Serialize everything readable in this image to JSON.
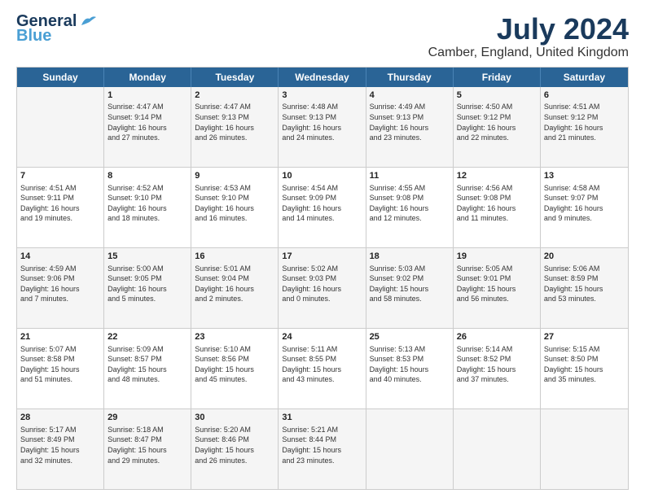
{
  "logo": {
    "line1": "General",
    "line2": "Blue"
  },
  "title": "July 2024",
  "subtitle": "Camber, England, United Kingdom",
  "days": [
    "Sunday",
    "Monday",
    "Tuesday",
    "Wednesday",
    "Thursday",
    "Friday",
    "Saturday"
  ],
  "weeks": [
    [
      {
        "day": "",
        "text": ""
      },
      {
        "day": "1",
        "text": "Sunrise: 4:47 AM\nSunset: 9:14 PM\nDaylight: 16 hours\nand 27 minutes."
      },
      {
        "day": "2",
        "text": "Sunrise: 4:47 AM\nSunset: 9:13 PM\nDaylight: 16 hours\nand 26 minutes."
      },
      {
        "day": "3",
        "text": "Sunrise: 4:48 AM\nSunset: 9:13 PM\nDaylight: 16 hours\nand 24 minutes."
      },
      {
        "day": "4",
        "text": "Sunrise: 4:49 AM\nSunset: 9:13 PM\nDaylight: 16 hours\nand 23 minutes."
      },
      {
        "day": "5",
        "text": "Sunrise: 4:50 AM\nSunset: 9:12 PM\nDaylight: 16 hours\nand 22 minutes."
      },
      {
        "day": "6",
        "text": "Sunrise: 4:51 AM\nSunset: 9:12 PM\nDaylight: 16 hours\nand 21 minutes."
      }
    ],
    [
      {
        "day": "7",
        "text": "Sunrise: 4:51 AM\nSunset: 9:11 PM\nDaylight: 16 hours\nand 19 minutes."
      },
      {
        "day": "8",
        "text": "Sunrise: 4:52 AM\nSunset: 9:10 PM\nDaylight: 16 hours\nand 18 minutes."
      },
      {
        "day": "9",
        "text": "Sunrise: 4:53 AM\nSunset: 9:10 PM\nDaylight: 16 hours\nand 16 minutes."
      },
      {
        "day": "10",
        "text": "Sunrise: 4:54 AM\nSunset: 9:09 PM\nDaylight: 16 hours\nand 14 minutes."
      },
      {
        "day": "11",
        "text": "Sunrise: 4:55 AM\nSunset: 9:08 PM\nDaylight: 16 hours\nand 12 minutes."
      },
      {
        "day": "12",
        "text": "Sunrise: 4:56 AM\nSunset: 9:08 PM\nDaylight: 16 hours\nand 11 minutes."
      },
      {
        "day": "13",
        "text": "Sunrise: 4:58 AM\nSunset: 9:07 PM\nDaylight: 16 hours\nand 9 minutes."
      }
    ],
    [
      {
        "day": "14",
        "text": "Sunrise: 4:59 AM\nSunset: 9:06 PM\nDaylight: 16 hours\nand 7 minutes."
      },
      {
        "day": "15",
        "text": "Sunrise: 5:00 AM\nSunset: 9:05 PM\nDaylight: 16 hours\nand 5 minutes."
      },
      {
        "day": "16",
        "text": "Sunrise: 5:01 AM\nSunset: 9:04 PM\nDaylight: 16 hours\nand 2 minutes."
      },
      {
        "day": "17",
        "text": "Sunrise: 5:02 AM\nSunset: 9:03 PM\nDaylight: 16 hours\nand 0 minutes."
      },
      {
        "day": "18",
        "text": "Sunrise: 5:03 AM\nSunset: 9:02 PM\nDaylight: 15 hours\nand 58 minutes."
      },
      {
        "day": "19",
        "text": "Sunrise: 5:05 AM\nSunset: 9:01 PM\nDaylight: 15 hours\nand 56 minutes."
      },
      {
        "day": "20",
        "text": "Sunrise: 5:06 AM\nSunset: 8:59 PM\nDaylight: 15 hours\nand 53 minutes."
      }
    ],
    [
      {
        "day": "21",
        "text": "Sunrise: 5:07 AM\nSunset: 8:58 PM\nDaylight: 15 hours\nand 51 minutes."
      },
      {
        "day": "22",
        "text": "Sunrise: 5:09 AM\nSunset: 8:57 PM\nDaylight: 15 hours\nand 48 minutes."
      },
      {
        "day": "23",
        "text": "Sunrise: 5:10 AM\nSunset: 8:56 PM\nDaylight: 15 hours\nand 45 minutes."
      },
      {
        "day": "24",
        "text": "Sunrise: 5:11 AM\nSunset: 8:55 PM\nDaylight: 15 hours\nand 43 minutes."
      },
      {
        "day": "25",
        "text": "Sunrise: 5:13 AM\nSunset: 8:53 PM\nDaylight: 15 hours\nand 40 minutes."
      },
      {
        "day": "26",
        "text": "Sunrise: 5:14 AM\nSunset: 8:52 PM\nDaylight: 15 hours\nand 37 minutes."
      },
      {
        "day": "27",
        "text": "Sunrise: 5:15 AM\nSunset: 8:50 PM\nDaylight: 15 hours\nand 35 minutes."
      }
    ],
    [
      {
        "day": "28",
        "text": "Sunrise: 5:17 AM\nSunset: 8:49 PM\nDaylight: 15 hours\nand 32 minutes."
      },
      {
        "day": "29",
        "text": "Sunrise: 5:18 AM\nSunset: 8:47 PM\nDaylight: 15 hours\nand 29 minutes."
      },
      {
        "day": "30",
        "text": "Sunrise: 5:20 AM\nSunset: 8:46 PM\nDaylight: 15 hours\nand 26 minutes."
      },
      {
        "day": "31",
        "text": "Sunrise: 5:21 AM\nSunset: 8:44 PM\nDaylight: 15 hours\nand 23 minutes."
      },
      {
        "day": "",
        "text": ""
      },
      {
        "day": "",
        "text": ""
      },
      {
        "day": "",
        "text": ""
      }
    ]
  ],
  "alt_rows": [
    0,
    2,
    4
  ]
}
